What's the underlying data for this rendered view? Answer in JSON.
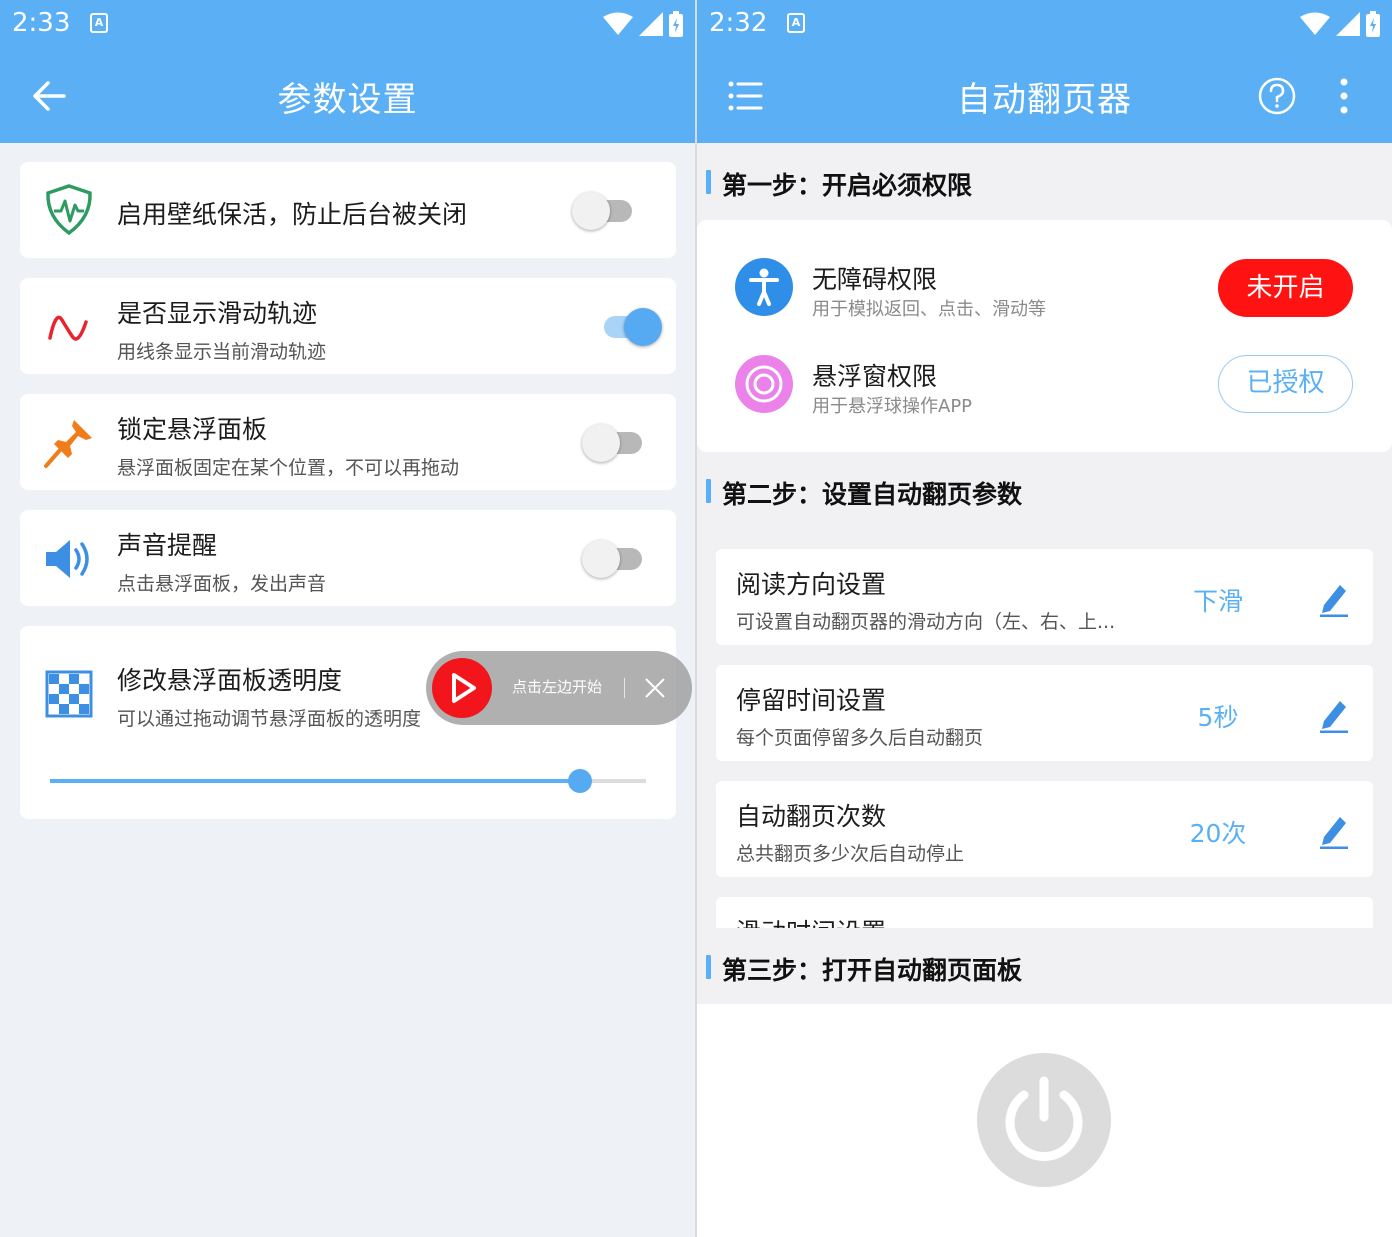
{
  "left": {
    "status": {
      "time": "2:33",
      "badge": "A"
    },
    "header": {
      "title": "参数设置"
    },
    "settings": [
      {
        "title": "启用壁纸保活，防止后台被关闭",
        "enabled": false
      },
      {
        "title": "是否显示滑动轨迹",
        "subtitle": "用线条显示当前滑动轨迹",
        "enabled": true
      },
      {
        "title": "锁定悬浮面板",
        "subtitle": "悬浮面板固定在某个位置，不可以再拖动",
        "enabled": false
      },
      {
        "title": "声音提醒",
        "subtitle": "点击悬浮面板，发出声音",
        "enabled": false
      }
    ],
    "opacity": {
      "title": "修改悬浮面板透明度",
      "subtitle": "可以通过拖动调节悬浮面板的透明度",
      "slider_value": 0.89
    },
    "float_panel": {
      "hint": "点击左边开始"
    }
  },
  "right": {
    "status": {
      "time": "2:32",
      "badge": "A"
    },
    "header": {
      "title": "自动翻页器"
    },
    "step1": {
      "label": "第一步：开启必须权限",
      "permissions": [
        {
          "title": "无障碍权限",
          "subtitle": "用于模拟返回、点击、滑动等",
          "button": "未开启"
        },
        {
          "title": "悬浮窗权限",
          "subtitle": "用于悬浮球操作APP",
          "button": "已授权"
        }
      ]
    },
    "step2": {
      "label": "第二步：设置自动翻页参数",
      "params": [
        {
          "title": "阅读方向设置",
          "subtitle": "可设置自动翻页器的滑动方向（左、右、上...",
          "value": "下滑"
        },
        {
          "title": "停留时间设置",
          "subtitle": "每个页面停留多久后自动翻页",
          "value": "5秒"
        },
        {
          "title": "自动翻页次数",
          "subtitle": "总共翻页多少次后自动停止",
          "value": "20次"
        },
        {
          "title": "滑动时间设置"
        }
      ]
    },
    "step3": {
      "label": "第三步：打开自动翻页面板"
    }
  },
  "colors": {
    "primary": "#5bb0f5",
    "danger": "#ff1212",
    "background": "#eef1f5"
  },
  "icons": {
    "left_back": "arrow-left-icon",
    "right_menu": "menu-icon",
    "right_help": "help-icon",
    "right_more": "more-vertical-icon"
  }
}
